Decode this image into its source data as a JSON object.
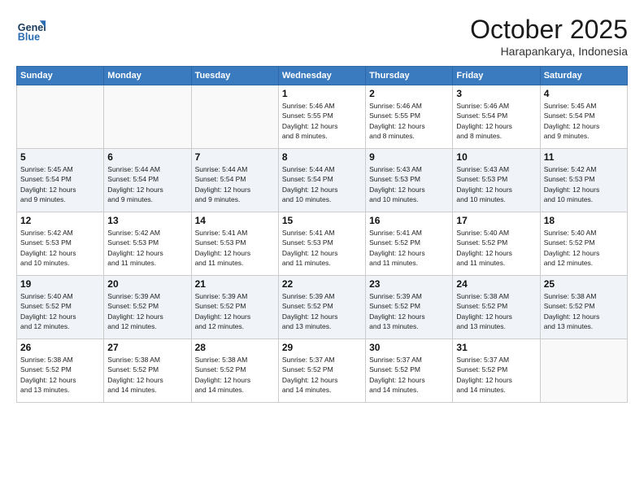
{
  "logo": {
    "line1": "General",
    "line2": "Blue"
  },
  "title": "October 2025",
  "subtitle": "Harapankarya, Indonesia",
  "weekdays": [
    "Sunday",
    "Monday",
    "Tuesday",
    "Wednesday",
    "Thursday",
    "Friday",
    "Saturday"
  ],
  "weeks": [
    [
      {
        "day": "",
        "info": ""
      },
      {
        "day": "",
        "info": ""
      },
      {
        "day": "",
        "info": ""
      },
      {
        "day": "1",
        "info": "Sunrise: 5:46 AM\nSunset: 5:55 PM\nDaylight: 12 hours\nand 8 minutes."
      },
      {
        "day": "2",
        "info": "Sunrise: 5:46 AM\nSunset: 5:55 PM\nDaylight: 12 hours\nand 8 minutes."
      },
      {
        "day": "3",
        "info": "Sunrise: 5:46 AM\nSunset: 5:54 PM\nDaylight: 12 hours\nand 8 minutes."
      },
      {
        "day": "4",
        "info": "Sunrise: 5:45 AM\nSunset: 5:54 PM\nDaylight: 12 hours\nand 9 minutes."
      }
    ],
    [
      {
        "day": "5",
        "info": "Sunrise: 5:45 AM\nSunset: 5:54 PM\nDaylight: 12 hours\nand 9 minutes."
      },
      {
        "day": "6",
        "info": "Sunrise: 5:44 AM\nSunset: 5:54 PM\nDaylight: 12 hours\nand 9 minutes."
      },
      {
        "day": "7",
        "info": "Sunrise: 5:44 AM\nSunset: 5:54 PM\nDaylight: 12 hours\nand 9 minutes."
      },
      {
        "day": "8",
        "info": "Sunrise: 5:44 AM\nSunset: 5:54 PM\nDaylight: 12 hours\nand 10 minutes."
      },
      {
        "day": "9",
        "info": "Sunrise: 5:43 AM\nSunset: 5:53 PM\nDaylight: 12 hours\nand 10 minutes."
      },
      {
        "day": "10",
        "info": "Sunrise: 5:43 AM\nSunset: 5:53 PM\nDaylight: 12 hours\nand 10 minutes."
      },
      {
        "day": "11",
        "info": "Sunrise: 5:42 AM\nSunset: 5:53 PM\nDaylight: 12 hours\nand 10 minutes."
      }
    ],
    [
      {
        "day": "12",
        "info": "Sunrise: 5:42 AM\nSunset: 5:53 PM\nDaylight: 12 hours\nand 10 minutes."
      },
      {
        "day": "13",
        "info": "Sunrise: 5:42 AM\nSunset: 5:53 PM\nDaylight: 12 hours\nand 11 minutes."
      },
      {
        "day": "14",
        "info": "Sunrise: 5:41 AM\nSunset: 5:53 PM\nDaylight: 12 hours\nand 11 minutes."
      },
      {
        "day": "15",
        "info": "Sunrise: 5:41 AM\nSunset: 5:53 PM\nDaylight: 12 hours\nand 11 minutes."
      },
      {
        "day": "16",
        "info": "Sunrise: 5:41 AM\nSunset: 5:52 PM\nDaylight: 12 hours\nand 11 minutes."
      },
      {
        "day": "17",
        "info": "Sunrise: 5:40 AM\nSunset: 5:52 PM\nDaylight: 12 hours\nand 11 minutes."
      },
      {
        "day": "18",
        "info": "Sunrise: 5:40 AM\nSunset: 5:52 PM\nDaylight: 12 hours\nand 12 minutes."
      }
    ],
    [
      {
        "day": "19",
        "info": "Sunrise: 5:40 AM\nSunset: 5:52 PM\nDaylight: 12 hours\nand 12 minutes."
      },
      {
        "day": "20",
        "info": "Sunrise: 5:39 AM\nSunset: 5:52 PM\nDaylight: 12 hours\nand 12 minutes."
      },
      {
        "day": "21",
        "info": "Sunrise: 5:39 AM\nSunset: 5:52 PM\nDaylight: 12 hours\nand 12 minutes."
      },
      {
        "day": "22",
        "info": "Sunrise: 5:39 AM\nSunset: 5:52 PM\nDaylight: 12 hours\nand 13 minutes."
      },
      {
        "day": "23",
        "info": "Sunrise: 5:39 AM\nSunset: 5:52 PM\nDaylight: 12 hours\nand 13 minutes."
      },
      {
        "day": "24",
        "info": "Sunrise: 5:38 AM\nSunset: 5:52 PM\nDaylight: 12 hours\nand 13 minutes."
      },
      {
        "day": "25",
        "info": "Sunrise: 5:38 AM\nSunset: 5:52 PM\nDaylight: 12 hours\nand 13 minutes."
      }
    ],
    [
      {
        "day": "26",
        "info": "Sunrise: 5:38 AM\nSunset: 5:52 PM\nDaylight: 12 hours\nand 13 minutes."
      },
      {
        "day": "27",
        "info": "Sunrise: 5:38 AM\nSunset: 5:52 PM\nDaylight: 12 hours\nand 14 minutes."
      },
      {
        "day": "28",
        "info": "Sunrise: 5:38 AM\nSunset: 5:52 PM\nDaylight: 12 hours\nand 14 minutes."
      },
      {
        "day": "29",
        "info": "Sunrise: 5:37 AM\nSunset: 5:52 PM\nDaylight: 12 hours\nand 14 minutes."
      },
      {
        "day": "30",
        "info": "Sunrise: 5:37 AM\nSunset: 5:52 PM\nDaylight: 12 hours\nand 14 minutes."
      },
      {
        "day": "31",
        "info": "Sunrise: 5:37 AM\nSunset: 5:52 PM\nDaylight: 12 hours\nand 14 minutes."
      },
      {
        "day": "",
        "info": ""
      }
    ]
  ]
}
